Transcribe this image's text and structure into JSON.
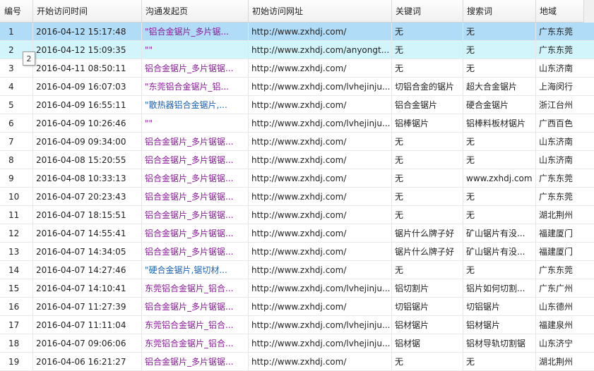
{
  "columns": [
    "编号",
    "开始访问时间",
    "沟通发起页",
    "初始访问网址",
    "关键词",
    "搜索词",
    "地域"
  ],
  "tooltip": "2",
  "rows": [
    {
      "id": "1",
      "time": "2016-04-12 15:17:48",
      "source": "\"铝合金锯片_多片锯...",
      "source_color": "purple",
      "url": "http://www.zxhdj.com/",
      "keyword": "无",
      "search": "无",
      "region": "广东东莞",
      "state": "selected"
    },
    {
      "id": "2",
      "time": "2016-04-12 15:09:35",
      "source": "\"\"",
      "source_color": "purple",
      "url": "http://www.zxhdj.com/anyongt...",
      "keyword": "无",
      "search": "无",
      "region": "广东东莞",
      "state": "hover"
    },
    {
      "id": "3",
      "time": "2016-04-11 08:50:11",
      "source": "铝合金锯片_多片锯锯...",
      "source_color": "purple",
      "url": "http://www.zxhdj.com/",
      "keyword": "无",
      "search": "无",
      "region": "山东济南",
      "state": ""
    },
    {
      "id": "4",
      "time": "2016-04-09 16:07:03",
      "source": "\"东莞铝合金锯片_铝...",
      "source_color": "purple",
      "url": "http://www.zxhdj.com/lvhejinju...",
      "keyword": "切铝合金的锯片",
      "search": "超大合金锯片",
      "region": "上海闵行",
      "state": ""
    },
    {
      "id": "5",
      "time": "2016-04-09 16:55:11",
      "source": "\"散热器铝合金锯片,...",
      "source_color": "blue",
      "url": "http://www.zxhdj.com/",
      "keyword": "铝合金锯片",
      "search": "硬合金锯片",
      "region": "浙江台州",
      "state": ""
    },
    {
      "id": "6",
      "time": "2016-04-09 10:26:46",
      "source": "\"\"",
      "source_color": "purple",
      "url": "http://www.zxhdj.com/lvhejinju...",
      "keyword": "铝棒锯片",
      "search": "铝棒料板材锯片",
      "region": "广西百色",
      "state": ""
    },
    {
      "id": "7",
      "time": "2016-04-09 09:34:00",
      "source": "铝合金锯片_多片锯锯...",
      "source_color": "purple",
      "url": "http://www.zxhdj.com/",
      "keyword": "无",
      "search": "无",
      "region": "山东济南",
      "state": ""
    },
    {
      "id": "8",
      "time": "2016-04-08 15:20:55",
      "source": "铝合金锯片_多片锯锯...",
      "source_color": "purple",
      "url": "http://www.zxhdj.com/",
      "keyword": "无",
      "search": "无",
      "region": "山东济南",
      "state": ""
    },
    {
      "id": "9",
      "time": "2016-04-08 10:33:13",
      "source": "铝合金锯片_多片锯锯...",
      "source_color": "purple",
      "url": "http://www.zxhdj.com/",
      "keyword": "无",
      "search": "www.zxhdj.com",
      "region": "广东东莞",
      "state": ""
    },
    {
      "id": "10",
      "time": "2016-04-07 20:23:43",
      "source": "铝合金锯片_多片锯锯...",
      "source_color": "purple",
      "url": "http://www.zxhdj.com/",
      "keyword": "无",
      "search": "无",
      "region": "广东东莞",
      "state": ""
    },
    {
      "id": "11",
      "time": "2016-04-07 18:15:51",
      "source": "铝合金锯片_多片锯锯...",
      "source_color": "purple",
      "url": "http://www.zxhdj.com/",
      "keyword": "无",
      "search": "无",
      "region": "湖北荆州",
      "state": ""
    },
    {
      "id": "12",
      "time": "2016-04-07 14:55:41",
      "source": "铝合金锯片_多片锯锯...",
      "source_color": "purple",
      "url": "http://www.zxhdj.com/",
      "keyword": "锯片什么牌子好",
      "search": "矿山锯片有没...",
      "region": "福建厦门",
      "state": ""
    },
    {
      "id": "13",
      "time": "2016-04-07 14:34:05",
      "source": "铝合金锯片_多片锯锯...",
      "source_color": "purple",
      "url": "http://www.zxhdj.com/",
      "keyword": "锯片什么牌子好",
      "search": "矿山锯片有没...",
      "region": "福建厦门",
      "state": ""
    },
    {
      "id": "14",
      "time": "2016-04-07 14:27:46",
      "source": "\"硬合金锯片,锯切材...",
      "source_color": "blue",
      "url": "http://www.zxhdj.com/",
      "keyword": "无",
      "search": "无",
      "region": "广东东莞",
      "state": ""
    },
    {
      "id": "15",
      "time": "2016-04-07 14:10:41",
      "source": "东莞铝合金锯片_铝合...",
      "source_color": "purple",
      "url": "http://www.zxhdj.com/lvhejinju...",
      "keyword": "铝切割片",
      "search": "铝片如何切割...",
      "region": "广东广州",
      "state": ""
    },
    {
      "id": "16",
      "time": "2016-04-07 11:27:39",
      "source": "铝合金锯片_多片锯锯...",
      "source_color": "purple",
      "url": "http://www.zxhdj.com/",
      "keyword": "切铝锯片",
      "search": "切铝锯片",
      "region": "山东德州",
      "state": ""
    },
    {
      "id": "17",
      "time": "2016-04-07 11:11:04",
      "source": "东莞铝合金锯片_铝合...",
      "source_color": "purple",
      "url": "http://www.zxhdj.com/lvhejinju...",
      "keyword": "铝材锯片",
      "search": "铝材锯片",
      "region": "福建泉州",
      "state": ""
    },
    {
      "id": "18",
      "time": "2016-04-07 09:06:06",
      "source": "东莞铝合金锯片_铝合...",
      "source_color": "purple",
      "url": "http://www.zxhdj.com/lvhejinju...",
      "keyword": "铝材锯",
      "search": "铝材导轨切割锯",
      "region": "山东济宁",
      "state": ""
    },
    {
      "id": "19",
      "time": "2016-04-06 16:21:27",
      "source": "铝合金锯片_多片锯锯...",
      "source_color": "purple",
      "url": "http://www.zxhdj.com/",
      "keyword": "无",
      "search": "无",
      "region": "湖北荆州",
      "state": ""
    }
  ]
}
